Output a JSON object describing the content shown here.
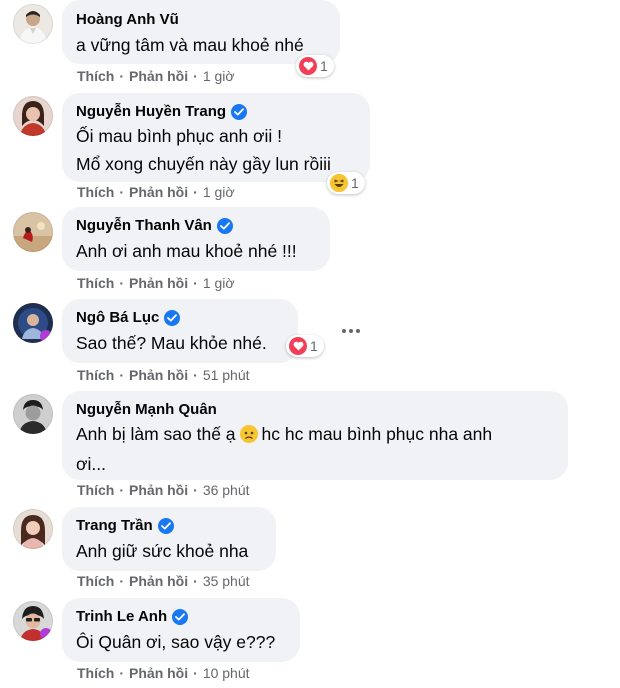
{
  "labels": {
    "like": "Thích",
    "reply": "Phản hồi",
    "separator": "·"
  },
  "comments": [
    {
      "name": "Hoàng Anh Vũ",
      "verified": false,
      "lines": [
        "a vững tâm và mau khoẻ nhé"
      ],
      "time": "1 giờ",
      "reaction": {
        "type": "love",
        "count": "1"
      }
    },
    {
      "name": "Nguyễn Huyền Trang",
      "verified": true,
      "lines": [
        "Ối mau bình phục anh ơii !",
        "Mổ xong chuyến này gầy lun rồiii"
      ],
      "time": "1 giờ",
      "reaction": {
        "type": "haha",
        "count": "1"
      }
    },
    {
      "name": "Nguyễn Thanh Vân",
      "verified": true,
      "lines": [
        "Anh ơi anh mau khoẻ nhé !!!"
      ],
      "time": "1 giờ"
    },
    {
      "name": "Ngô Bá Lục",
      "verified": true,
      "lines": [
        "Sao thế? Mau khỏe nhé."
      ],
      "time": "51 phút",
      "reaction": {
        "type": "love",
        "count": "1"
      }
    },
    {
      "name": "Nguyễn Mạnh Quân",
      "verified": false,
      "lines": [
        "Anh bị làm sao thế ạ",
        "hc hc mau bình phục nha anh",
        "ơi..."
      ],
      "time": "36 phút"
    },
    {
      "name": "Trang Trần",
      "verified": true,
      "lines": [
        "Anh giữ sức khoẻ nha"
      ],
      "time": "35 phút"
    },
    {
      "name": "Trinh Le Anh",
      "verified": true,
      "lines": [
        "Ôi Quân ơi, sao vậy e???"
      ],
      "time": "10 phút"
    }
  ],
  "icons": {
    "verified": "verified-badge-icon",
    "love": "love-reaction-icon",
    "haha": "haha-reaction-icon",
    "sad": "sad-emoji-icon",
    "more": "more-options-icon"
  },
  "colors": {
    "bubble": "#f0f2f5",
    "verified": "#1877f2",
    "love": "#f33e58",
    "meta": "#65676b"
  }
}
